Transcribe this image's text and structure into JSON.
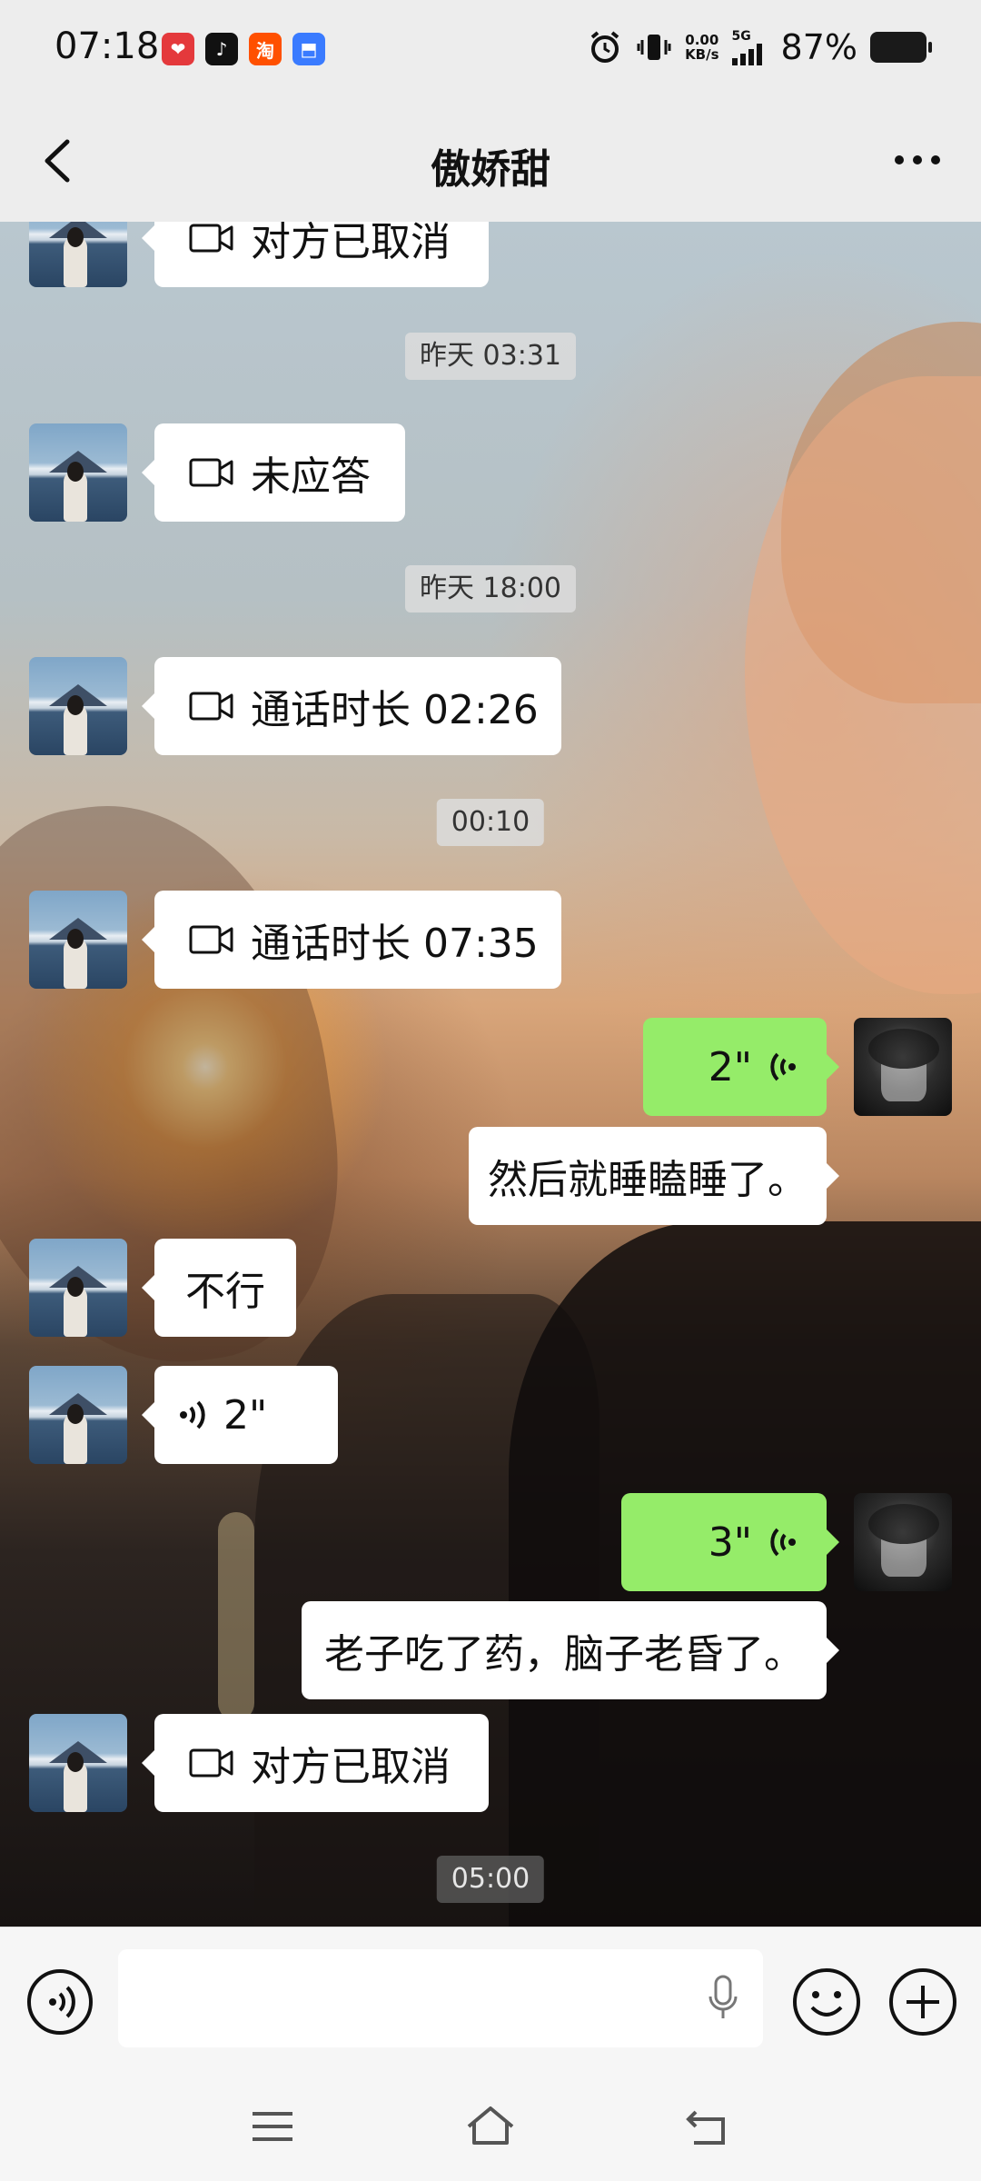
{
  "status_bar": {
    "time": "07:18",
    "app_icons": [
      "pinduoduo-icon",
      "tiktok-icon",
      "taobao-icon",
      "app-icon"
    ],
    "net_speed_value": "0.00",
    "net_speed_unit": "KB/s",
    "network": "5G",
    "battery": "87%"
  },
  "header": {
    "title": "傲娇甜"
  },
  "messages": [
    {
      "type": "call",
      "text": "对方已取消"
    },
    {
      "type": "time",
      "text": "昨天 03:31"
    },
    {
      "type": "call",
      "text": "未应答"
    },
    {
      "type": "time",
      "text": "昨天 18:00"
    },
    {
      "type": "call",
      "text": "通话时长 02:26"
    },
    {
      "type": "time",
      "text": "00:10"
    },
    {
      "type": "call",
      "text": "通话时长 07:35"
    },
    {
      "type": "voice_out",
      "text": "2\""
    },
    {
      "type": "text_out",
      "text": "然后就睡瞌睡了。"
    },
    {
      "type": "text_in",
      "text": "不行"
    },
    {
      "type": "voice_in",
      "text": "2\""
    },
    {
      "type": "voice_out",
      "text": "3\""
    },
    {
      "type": "text_out",
      "text": "老子吃了药，脑子老昏了。"
    },
    {
      "type": "call",
      "text": "对方已取消"
    },
    {
      "type": "time",
      "text": "05:00"
    }
  ],
  "colors": {
    "self_bubble": "#95ec69",
    "other_bubble": "#ffffff",
    "bar": "#ededed"
  }
}
